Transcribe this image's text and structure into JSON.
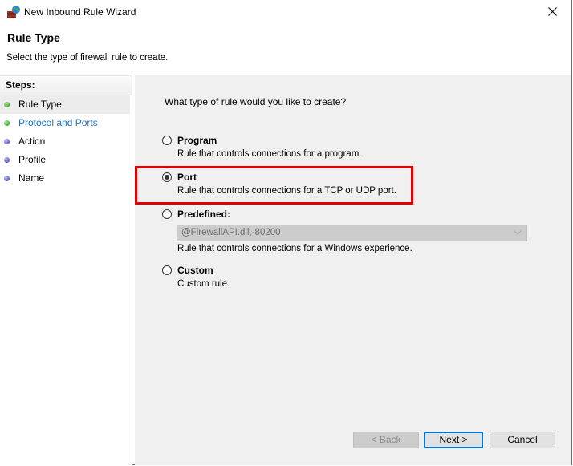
{
  "window": {
    "title": "New Inbound Rule Wizard",
    "icon": "firewall-icon"
  },
  "header": {
    "title": "Rule Type",
    "subtitle": "Select the type of firewall rule to create."
  },
  "steps": {
    "heading": "Steps:",
    "items": [
      {
        "label": "Rule Type",
        "status": "current",
        "dot_color": "#3fb52a"
      },
      {
        "label": "Protocol and Ports",
        "status": "link",
        "dot_color": "#3fb52a"
      },
      {
        "label": "Action",
        "status": "pending",
        "dot_color": "#5e5ed0"
      },
      {
        "label": "Profile",
        "status": "pending",
        "dot_color": "#5e5ed0"
      },
      {
        "label": "Name",
        "status": "pending",
        "dot_color": "#5e5ed0"
      }
    ]
  },
  "main": {
    "question": "What type of rule would you like to create?",
    "options": [
      {
        "label": "Program",
        "description": "Rule that controls connections for a program.",
        "checked": false
      },
      {
        "label": "Port",
        "description": "Rule that controls connections for a TCP or UDP port.",
        "checked": true
      },
      {
        "label": "Predefined:",
        "description": "Rule that controls connections for a Windows experience.",
        "checked": false
      },
      {
        "label": "Custom",
        "description": "Custom rule.",
        "checked": false
      }
    ],
    "predefined_dropdown": {
      "value": "@FirewallAPI.dll,-80200",
      "enabled": false
    },
    "highlight_color": "#e00000"
  },
  "buttons": {
    "back": "< Back",
    "next": "Next >",
    "cancel": "Cancel"
  }
}
